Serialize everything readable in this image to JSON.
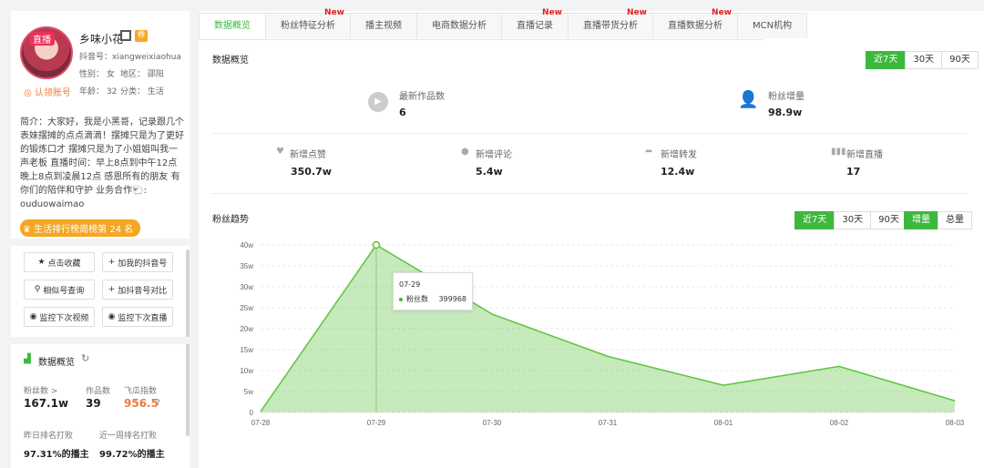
{
  "profile": {
    "live_badge": "直播",
    "nickname": "乡味小花",
    "shop_icon": "券",
    "douyin_id": "抖音号：xiangweixiaohua",
    "gender": "性别： 女",
    "region": "地区： 邵阳",
    "age": "年龄： 32",
    "category": "分类： 生活",
    "verify": "认领账号",
    "intro": "简介：大家好，我是小黑哥，记录跟几个表妹摆摊的点点滴滴！摆摊只是为了更好的锻炼口才 摆摊只是为了小姐姐叫我一声老板 直播时间：早上8点到中午12点 晚上8点到凌晨12点 感恩所有的朋友 有你们的陪伴和守护 业务合作🐑: ouduowaimao",
    "rank": "生活排行榜周榜第 24 名"
  },
  "actions": {
    "collect": "点击收藏",
    "add_my": "加我的抖音号",
    "similar": "相似号查询",
    "compare": "加抖音号对比",
    "monitor_video": "监控下次视频",
    "monitor_live": "监控下次直播"
  },
  "data_overview": {
    "title": "数据概览",
    "fans_label": "粉丝数 >",
    "fans_value": "167.1w",
    "works_label": "作品数",
    "works_value": "39",
    "index_label": "飞瓜指数",
    "index_value": "956.5",
    "yday_label": "昨日排名打败",
    "yday_value": "97.31%的播主",
    "week_label": "近一周排名打败",
    "week_value": "99.72%的播主"
  },
  "tabs": [
    {
      "label": "数据概览",
      "new": ""
    },
    {
      "label": "粉丝特征分析",
      "new": "New"
    },
    {
      "label": "播主视频",
      "new": ""
    },
    {
      "label": "电商数据分析",
      "new": ""
    },
    {
      "label": "直播记录",
      "new": "New"
    },
    {
      "label": "直播带货分析",
      "new": "New"
    },
    {
      "label": "直播数据分析",
      "new": "New"
    },
    {
      "label": "MCN机构",
      "new": ""
    }
  ],
  "overview": {
    "title": "数据概览",
    "range": [
      "近7天",
      "30天",
      "90天"
    ],
    "new_works_label": "最新作品数",
    "new_works_value": "6",
    "fans_inc_label": "粉丝增量",
    "fans_inc_value": "98.9w",
    "likes_label": "新增点赞",
    "likes_value": "350.7w",
    "comments_label": "新增评论",
    "comments_value": "5.4w",
    "shares_label": "新增转发",
    "shares_value": "12.4w",
    "lives_label": "新增直播",
    "lives_value": "17"
  },
  "trend": {
    "title": "粉丝趋势",
    "range": [
      "近7天",
      "30天",
      "90天"
    ],
    "mode": [
      "增量",
      "总量"
    ],
    "tooltip_date": "07-29",
    "tooltip_label": "粉丝数",
    "tooltip_value": "399968"
  },
  "chart_data": {
    "type": "area",
    "x": [
      "07-28",
      "07-29",
      "07-30",
      "07-31",
      "08-01",
      "08-02",
      "08-03"
    ],
    "series": [
      {
        "values": [
          2000,
          399968,
          235000,
          134000,
          65000,
          110000,
          28000
        ]
      }
    ],
    "ylim": [
      0,
      400000
    ],
    "yticks": [
      "0",
      "5w",
      "10w",
      "15w",
      "20w",
      "25w",
      "30w",
      "35w",
      "40w"
    ],
    "grid": true,
    "color": "#5cc43c"
  }
}
